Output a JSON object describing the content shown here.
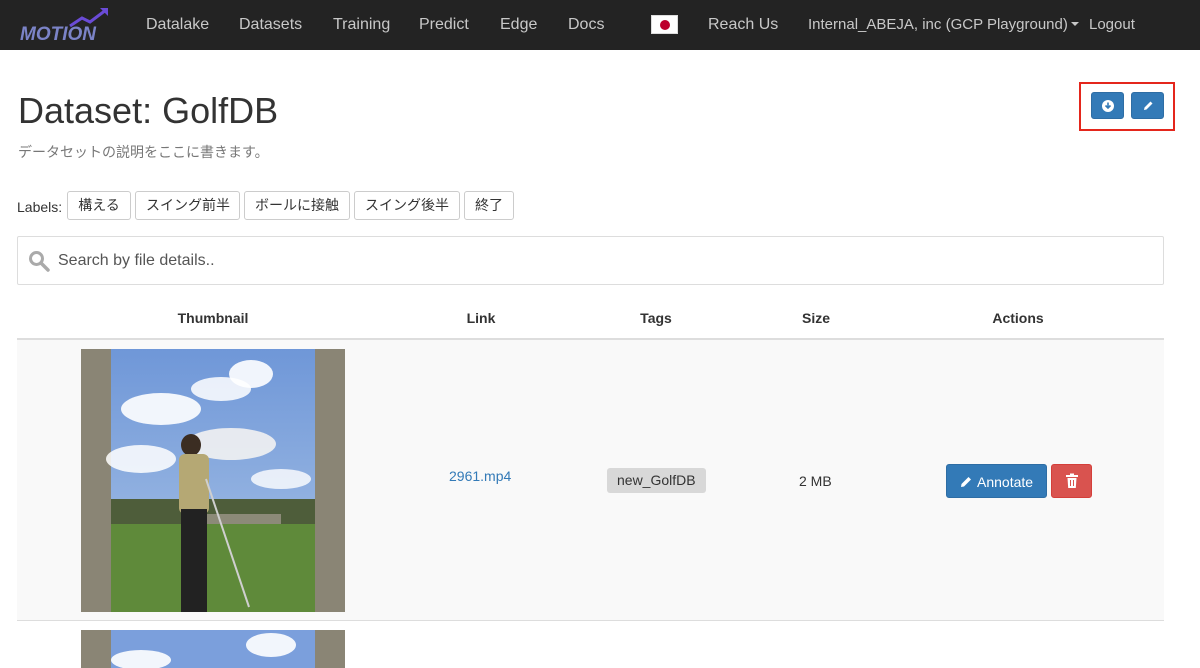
{
  "navbar": {
    "logo_text": "MOTION",
    "items": [
      {
        "label": "Datalake"
      },
      {
        "label": "Datasets"
      },
      {
        "label": "Training"
      },
      {
        "label": "Predict"
      },
      {
        "label": "Edge"
      },
      {
        "label": "Docs"
      }
    ],
    "language_flag": "japan-flag-icon",
    "reach_us": "Reach Us",
    "organization": "Internal_ABEJA, inc (GCP Playground)",
    "logout": "Logout"
  },
  "page": {
    "title_prefix": "Dataset: ",
    "title_name": "GolfDB",
    "description": "データセットの説明をここに書きます。",
    "actions": {
      "download_icon": "download-circle-icon",
      "edit_icon": "pencil-icon"
    }
  },
  "labels": {
    "title": "Labels:",
    "items": [
      "構える",
      "スイング前半",
      "ボールに接触",
      "スイング後半",
      "終了"
    ]
  },
  "search": {
    "placeholder": "Search by file details.."
  },
  "table": {
    "headers": [
      "Thumbnail",
      "Link",
      "Tags",
      "Size",
      "Actions"
    ],
    "rows": [
      {
        "thumbnail_alt": "golfer swing frame",
        "link": "2961.mp4",
        "tag": "new_GolfDB",
        "size": "2 MB",
        "annotate_label": "Annotate",
        "delete_icon": "trash-icon"
      }
    ]
  },
  "colors": {
    "navbar_bg": "#232323",
    "primary": "#337ab7",
    "danger": "#d9534f",
    "highlight": "#e4261c"
  }
}
